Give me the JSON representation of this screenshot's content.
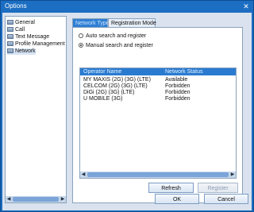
{
  "window": {
    "title": "Options"
  },
  "sidebar": {
    "items": [
      {
        "label": "General"
      },
      {
        "label": "Call"
      },
      {
        "label": "Text Message"
      },
      {
        "label": "Profile Management"
      },
      {
        "label": "Network",
        "selected": true
      }
    ]
  },
  "tabs": [
    {
      "label": "Network Type",
      "active": true
    },
    {
      "label": "Registration Mode",
      "active": false
    }
  ],
  "registration": {
    "options": [
      {
        "label": "Auto search and register",
        "checked": false
      },
      {
        "label": "Manual search and register",
        "checked": true
      }
    ]
  },
  "network_list": {
    "headers": {
      "operator": "Operator Name",
      "status": "Network Status"
    },
    "rows": [
      {
        "operator": "MY MAXIS (2G) (3G) (LTE)",
        "status": "Available"
      },
      {
        "operator": "CELCOM (2G) (3G) (LTE)",
        "status": "Forbidden"
      },
      {
        "operator": "DiGi (2G) (3G) (LTE)",
        "status": "Forbidden"
      },
      {
        "operator": "U MOBILE (3G)",
        "status": "Forbidden"
      }
    ]
  },
  "buttons": {
    "refresh": "Refresh",
    "register": "Register",
    "ok": "OK",
    "cancel": "Cancel"
  },
  "colors": {
    "accent": "#2a7bd0",
    "window": "#1c6ec2"
  }
}
